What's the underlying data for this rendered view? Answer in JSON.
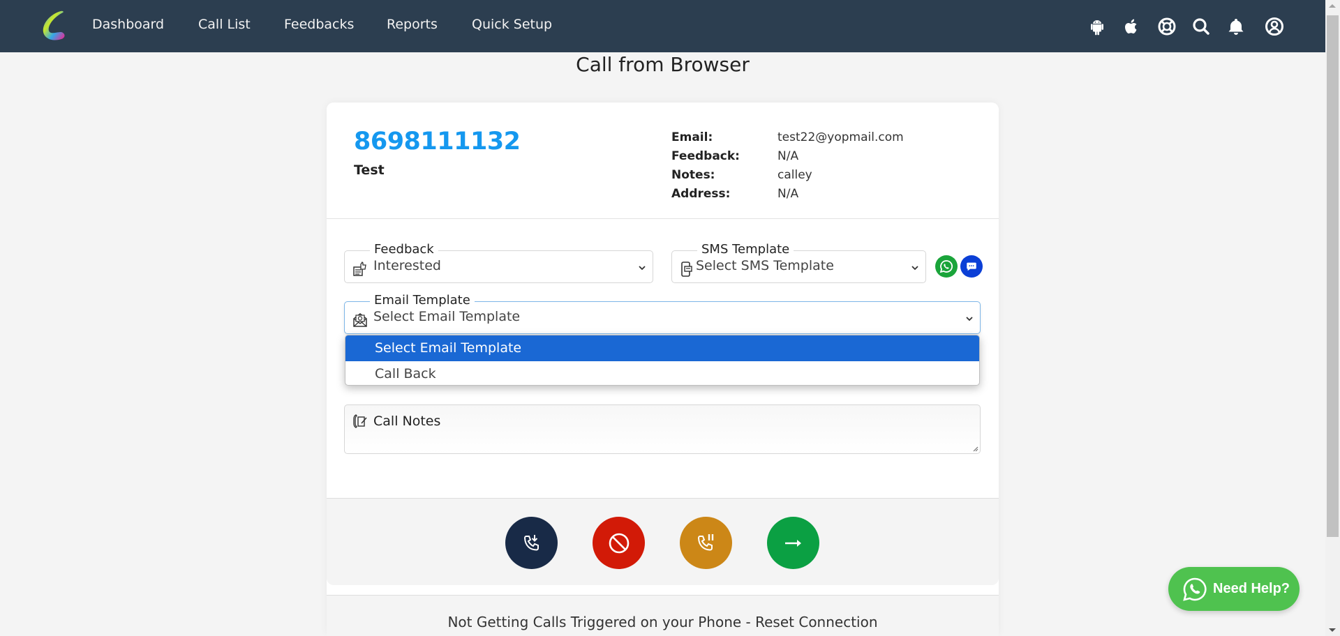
{
  "nav": {
    "links": [
      "Dashboard",
      "Call List",
      "Feedbacks",
      "Reports",
      "Quick Setup"
    ],
    "icons": [
      "android-icon",
      "apple-icon",
      "support-lifebuoy-icon",
      "search-icon",
      "bell-icon",
      "user-account-icon"
    ]
  },
  "page": {
    "title": "Call from Browser"
  },
  "contact": {
    "phone": "8698111132",
    "name": "Test",
    "info": [
      {
        "label": "Email:",
        "value": "test22@yopmail.com"
      },
      {
        "label": "Feedback:",
        "value": "N/A"
      },
      {
        "label": "Notes:",
        "value": "calley"
      },
      {
        "label": "Address:",
        "value": "N/A"
      }
    ]
  },
  "form": {
    "feedback": {
      "label": "Feedback",
      "value": "Interested"
    },
    "sms": {
      "label": "SMS Template",
      "value": "Select SMS Template"
    },
    "email": {
      "label": "Email Template",
      "value": "Select Email Template",
      "options": [
        "Select Email Template",
        "Call Back"
      ],
      "selected_index": 0
    },
    "notes": {
      "placeholder": "Call Notes"
    }
  },
  "actions": [
    {
      "name": "receive-call",
      "color": "#182a47"
    },
    {
      "name": "end-call",
      "color": "#d21a07"
    },
    {
      "name": "hold-call",
      "color": "#cc8717"
    },
    {
      "name": "next-call",
      "color": "#0ba043"
    }
  ],
  "footer": {
    "reset_text": "Not Getting Calls Triggered on your Phone - Reset Connection"
  },
  "help": {
    "label": "Need Help?"
  },
  "colors": {
    "navbar": "#2c3e50",
    "phone": "#1598ef",
    "whatsapp": "#1aa43a",
    "sms": "#0b3fd6",
    "dropdown_selected": "#1a68d4",
    "help": "#4fc24f"
  }
}
